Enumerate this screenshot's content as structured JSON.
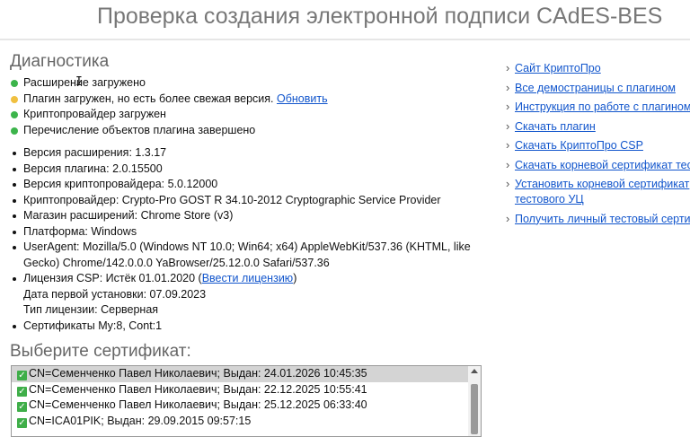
{
  "page": {
    "title": "Проверка создания электронной подписи CAdES-BES"
  },
  "diagnostics": {
    "title": "Диагностика",
    "statuses": [
      {
        "text": "Расширение загружено",
        "color": "#3cb44b",
        "link": ""
      },
      {
        "text": "Плагин загружен, но есть более свежая версия.",
        "color": "#f0c040",
        "link": "Обновить"
      },
      {
        "text": "Криптопровайдер загружен",
        "color": "#3cb44b",
        "link": ""
      },
      {
        "text": "Перечисление объектов плагина завершено",
        "color": "#3cb44b",
        "link": ""
      }
    ],
    "info": {
      "ext_version": "Версия расширения: 1.3.17",
      "plugin_version": "Версия плагина: 2.0.15500",
      "csp_version": "Версия криптопровайдера: 5.0.12000",
      "csp_name": "Криптопровайдер: Crypto-Pro GOST R 34.10-2012 Cryptographic Service Provider",
      "ext_store": "Магазин расширений: Chrome Store (v3)",
      "platform": "Платформа: Windows",
      "useragent": "UserAgent: Mozilla/5.0 (Windows NT 10.0; Win64; x64) AppleWebKit/537.36 (KHTML, like Gecko) Chrome/142.0.0.0 YaBrowser/25.12.0.0 Safari/537.36",
      "license_prefix": "Лицензия CSP: Истёк 01.01.2020 (",
      "license_link": "Ввести лицензию",
      "license_suffix": ")",
      "install_date": "Дата первой установки: 07.09.2023",
      "license_type": "Тип лицензии: Серверная",
      "certificates": "Сертификаты My:8, Cont:1"
    }
  },
  "cert_select": {
    "title": "Выберите сертификат:",
    "items": [
      {
        "label": "CN=Семенченко Павел Николаевич; Выдан: 24.01.2026 10:45:35",
        "selected": true
      },
      {
        "label": "CN=Семенченко Павел Николаевич; Выдан: 22.12.2025 10:55:41",
        "selected": false
      },
      {
        "label": "CN=Семенченко Павел Николаевич; Выдан: 25.12.2025 06:33:40",
        "selected": false
      },
      {
        "label": "CN=ICA01PIK; Выдан: 29.09.2015 09:57:15",
        "selected": false
      }
    ]
  },
  "sidebar": {
    "links": [
      "Сайт КриптоПро",
      "Все демостраницы с плагином",
      "Инструкция по работе с плагином",
      "Скачать плагин",
      "Скачать КриптоПро CSP",
      "Скачать корневой сертификат тестового УЦ",
      "Установить корневой сертификат тестового УЦ",
      "Получить личный тестовый сертификат"
    ]
  },
  "colors": {
    "ok": "#3cb44b",
    "warn": "#f0c040",
    "link": "#1155cc",
    "check": "#3fae49"
  }
}
